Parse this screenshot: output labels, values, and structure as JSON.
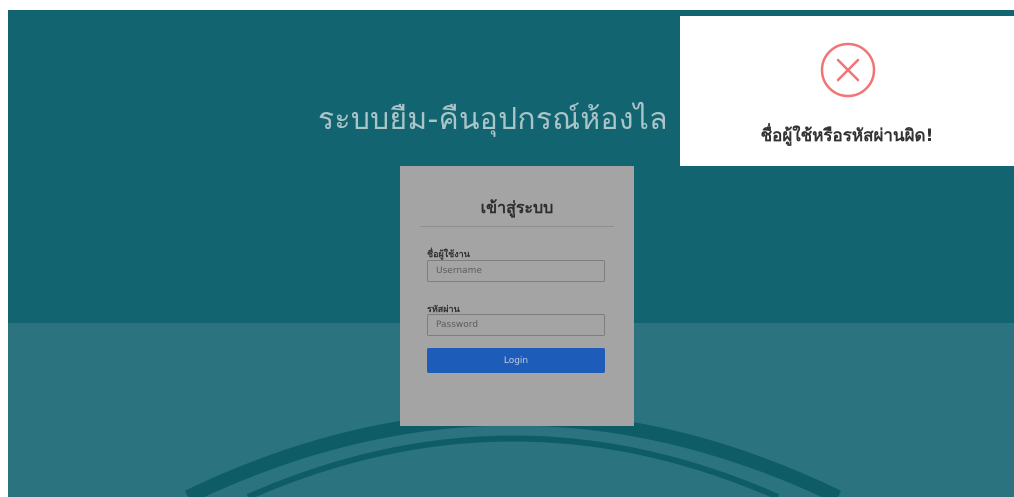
{
  "hero": {
    "title": "ระบบยืม-คืนอุปกรณ์ห้องไล"
  },
  "login": {
    "heading": "เข้าสู่ระบบ",
    "username_label": "ชื่อผู้ใช้งาน",
    "username_placeholder": "Username",
    "password_label": "รหัสผ่าน",
    "password_placeholder": "Password",
    "button_label": "Login"
  },
  "alert": {
    "icon": "error-x-circle-icon",
    "message": "ชื่อผู้ใช้หรือรหัสผ่านผิด!",
    "icon_color": "#f27474"
  },
  "colors": {
    "hero_top": "#116470",
    "hero_bottom": "#2b737e",
    "button": "#1d5cb9"
  }
}
